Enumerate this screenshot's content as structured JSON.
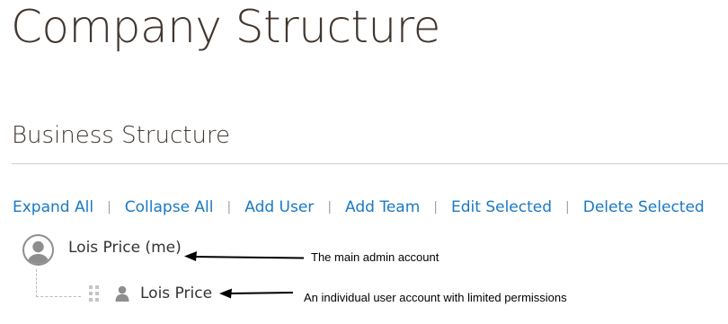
{
  "page": {
    "title": "Company Structure"
  },
  "section": {
    "title": "Business Structure"
  },
  "actions": [
    {
      "label": "Expand All"
    },
    {
      "label": "Collapse All"
    },
    {
      "label": "Add User"
    },
    {
      "label": "Add Team"
    },
    {
      "label": "Edit Selected"
    },
    {
      "label": "Delete Selected"
    }
  ],
  "actions_separator": "|",
  "tree": {
    "root": {
      "label": "Lois Price (me)",
      "icon": "user-avatar-icon"
    },
    "child": {
      "label": "Lois Price",
      "icons": [
        "drag-handle-icon",
        "user-icon"
      ]
    }
  },
  "annotations": {
    "root": "The main admin account",
    "child": "An individual user account with limited permissions"
  },
  "colors": {
    "title": "#41362f",
    "link": "#1979c3",
    "text": "#333333",
    "divider": "#cccccc",
    "icon": "#8e8e8e",
    "annotation": "#000000"
  }
}
